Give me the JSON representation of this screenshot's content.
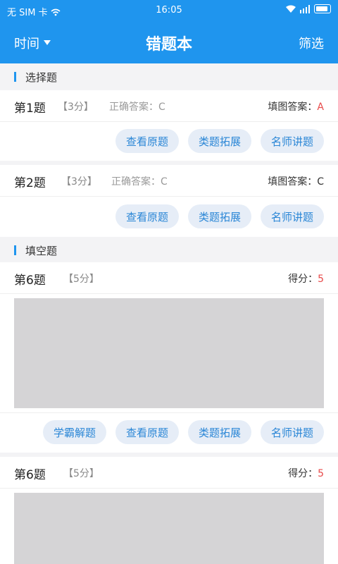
{
  "status": {
    "carrier": "无 SIM 卡",
    "time": "16:05"
  },
  "nav": {
    "left": "时间",
    "title": "错题本",
    "right": "筛选"
  },
  "sections": {
    "choice": "选择题",
    "fill": "填空题"
  },
  "q1": {
    "num": "第1题",
    "score": "【3分】",
    "correct_label": "正确答案：",
    "correct": "C",
    "fill_label": "填图答案：",
    "fill": "A"
  },
  "q2": {
    "num": "第2题",
    "score": "【3分】",
    "correct_label": "正确答案：",
    "correct": "C",
    "fill_label": "填图答案：",
    "fill": "C"
  },
  "q3": {
    "num": "第6题",
    "score": "【5分】",
    "score_label": "得分：",
    "got": "5"
  },
  "q4": {
    "num": "第6题",
    "score": "【5分】",
    "score_label": "得分：",
    "got": "5"
  },
  "buttons": {
    "study": "学霸解题",
    "view": "查看原题",
    "similar": "类题拓展",
    "teacher": "名师讲题"
  },
  "colors": {
    "primary": "#1f95ee",
    "wrong": "#e84a4a"
  }
}
